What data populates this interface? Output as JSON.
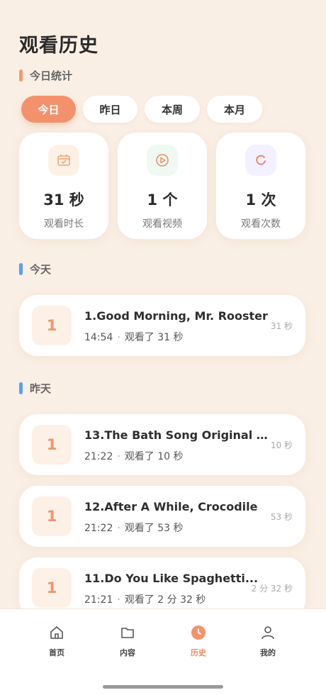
{
  "page": {
    "title": "观看历史"
  },
  "stats_section": {
    "label": "今日统计"
  },
  "tabs": [
    {
      "label": "今日",
      "active": true
    },
    {
      "label": "昨日",
      "active": false
    },
    {
      "label": "本周",
      "active": false
    },
    {
      "label": "本月",
      "active": false
    }
  ],
  "stats": [
    {
      "icon": "calendar-icon",
      "value": "31 秒",
      "label": "观看时长",
      "color": "#f2a679",
      "bg": "#fdf1e6"
    },
    {
      "icon": "play-circle-icon",
      "value": "1 个",
      "label": "观看视频",
      "color": "#e8906a",
      "bg": "#eefaf1"
    },
    {
      "icon": "refresh-icon",
      "value": "1 次",
      "label": "观看次数",
      "color": "#f07c66",
      "bg": "#f3f1fd"
    }
  ],
  "groups": {
    "today": {
      "label": "今天",
      "items": [
        {
          "thumb": "1",
          "title": "1.Good Morning, Mr. Rooster",
          "time": "14:54",
          "watched": "观看了 31 秒",
          "duration": "31 秒"
        }
      ]
    },
    "yesterday": {
      "label": "昨天",
      "items": [
        {
          "thumb": "1",
          "title": "13.The Bath Song Original K...",
          "time": "21:22",
          "watched": "观看了 10 秒",
          "duration": "10 秒"
        },
        {
          "thumb": "1",
          "title": "12.After A While, Crocodile",
          "time": "21:22",
          "watched": "观看了 53 秒",
          "duration": "53 秒"
        },
        {
          "thumb": "1",
          "title": "11.Do You Like Spaghetti...",
          "time": "21:21",
          "watched": "观看了 2 分 32 秒",
          "duration": "2 分 32 秒"
        }
      ]
    }
  },
  "meta_separator": "·",
  "bottom_nav": [
    {
      "icon": "home-icon",
      "label": "首页",
      "active": false
    },
    {
      "icon": "folder-icon",
      "label": "内容",
      "active": false
    },
    {
      "icon": "clock-icon",
      "label": "历史",
      "active": true
    },
    {
      "icon": "user-icon",
      "label": "我的",
      "active": false
    }
  ],
  "colors": {
    "accent": "#f4916d",
    "background": "#faefe5",
    "section_blue": "#5b9ef4"
  }
}
